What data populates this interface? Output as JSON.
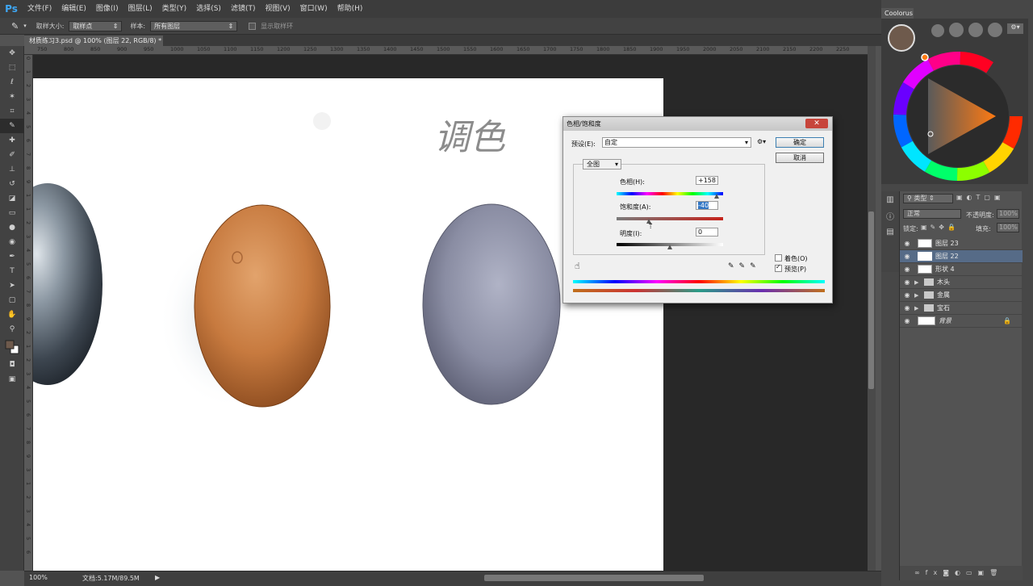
{
  "app": {
    "logo": "Ps",
    "menu": [
      "文件(F)",
      "编辑(E)",
      "图像(I)",
      "图层(L)",
      "类型(Y)",
      "选择(S)",
      "滤镜(T)",
      "视图(V)",
      "窗口(W)",
      "帮助(H)"
    ]
  },
  "options": {
    "sample_size_label": "取样大小:",
    "sample_size_value": "取样点",
    "sample_label": "样本:",
    "sample_value": "所有图层",
    "show_ring_label": "显示取样环"
  },
  "document": {
    "tab_title": "材质练习3.psd @ 100% (图层 22, RGB/8) *",
    "handwriting": "调色"
  },
  "rulers": {
    "h": [
      "750",
      "800",
      "850",
      "900",
      "950",
      "1000",
      "1050",
      "1100",
      "1150",
      "1200",
      "1250",
      "1300",
      "1350",
      "1400",
      "1450",
      "1500",
      "1550",
      "1600",
      "1650",
      "1700",
      "1750",
      "1800",
      "1850",
      "1900",
      "1950",
      "2000",
      "2050",
      "2100",
      "2150",
      "2200",
      "2250"
    ],
    "v": [
      "0",
      "1",
      "2",
      "3",
      "4",
      "5",
      "6",
      "7",
      "8",
      "9",
      "1",
      "1",
      "2",
      "3",
      "4",
      "5",
      "6",
      "7",
      "8",
      "9",
      "2",
      "1",
      "2",
      "3",
      "4",
      "5",
      "6",
      "7",
      "8",
      "9",
      "3",
      "1",
      "2",
      "3",
      "4",
      "5",
      "6"
    ]
  },
  "status": {
    "zoom": "100%",
    "doc_info": "文档:5.17M/89.5M"
  },
  "dialog": {
    "title": "色相/饱和度",
    "preset_label": "预设(E):",
    "preset_value": "自定",
    "ok": "确定",
    "cancel": "取消",
    "channel": "全图",
    "hue_label": "色相(H):",
    "hue_value": "+158",
    "sat_label": "饱和度(A):",
    "sat_value": "-40",
    "light_label": "明度(I):",
    "light_value": "0",
    "colorize_label": "着色(O)",
    "preview_label": "预览(P)",
    "colorize_checked": false,
    "preview_checked": true,
    "hue_level": 158,
    "sat_level": -40,
    "light_level": 0
  },
  "coolorus": {
    "tab": "Coolorus",
    "fg_color": "#6e5a4c",
    "bg_color": "#ffffff"
  },
  "layers": {
    "kind_label": "类型",
    "blend_mode": "正常",
    "opacity_label": "不透明度:",
    "opacity_value": "100%",
    "lock_label": "锁定:",
    "fill_label": "填充:",
    "fill_value": "100%",
    "items": [
      {
        "name": "图层 23",
        "type": "layer",
        "selected": false
      },
      {
        "name": "图层 22",
        "type": "layer",
        "selected": true
      },
      {
        "name": "形状 4",
        "type": "shape",
        "selected": false
      },
      {
        "name": "木头",
        "type": "group",
        "selected": false
      },
      {
        "name": "金属",
        "type": "group",
        "selected": false
      },
      {
        "name": "宝石",
        "type": "group",
        "selected": false
      },
      {
        "name": "背景",
        "type": "background",
        "selected": false
      }
    ]
  }
}
